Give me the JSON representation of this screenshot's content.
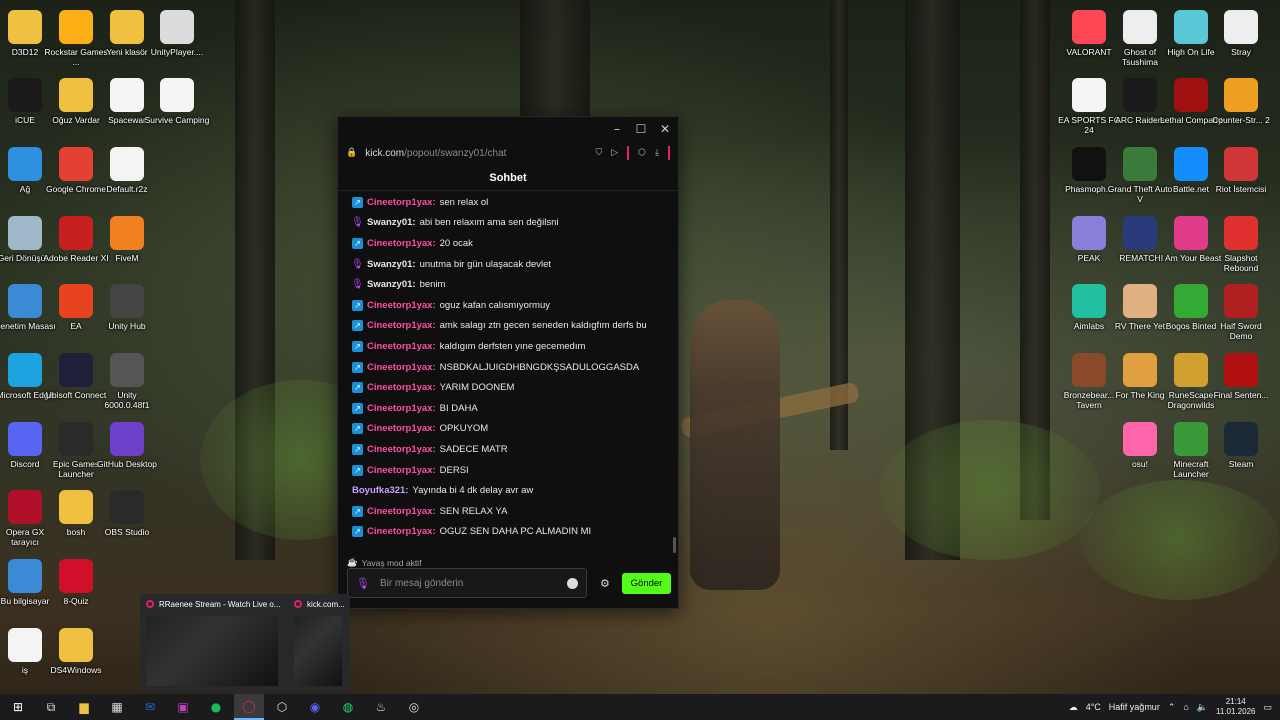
{
  "desktop_icons": [
    {
      "label": "D3D12",
      "icon": "folder-icon",
      "color": "#f0c040"
    },
    {
      "label": "Rockstar Games ...",
      "icon": "rockstar-icon",
      "color": "#fcaf17"
    },
    {
      "label": "Yeni klasör",
      "icon": "folder-icon",
      "color": "#f0c040"
    },
    {
      "label": "UnityPlayer....",
      "icon": "file-icon",
      "color": "#dcdcdc"
    },
    {
      "label": "iCUE",
      "icon": "icue-icon",
      "color": "#1a1a1a"
    },
    {
      "label": "Oğuz Vardar",
      "icon": "folder-icon",
      "color": "#f0c040"
    },
    {
      "label": "Spacewar",
      "icon": "file-icon",
      "color": "#f4f4f4"
    },
    {
      "label": "Survive Camping",
      "icon": "file-icon",
      "color": "#f4f4f4"
    },
    {
      "label": "Ağ",
      "icon": "network-icon",
      "color": "#2d8fe0"
    },
    {
      "label": "Google Chrome",
      "icon": "chrome-icon",
      "color": "#e44134"
    },
    {
      "label": "Default.r2z",
      "icon": "file-icon",
      "color": "#f4f4f4"
    },
    {
      "label": "Geri Dönüşü...",
      "icon": "recycle-bin-icon",
      "color": "#9fb7c9"
    },
    {
      "label": "Adobe Reader XI",
      "icon": "adobe-icon",
      "color": "#c8201e"
    },
    {
      "label": "FiveM",
      "icon": "fivem-icon",
      "color": "#f08020"
    },
    {
      "label": "Denetim Masası",
      "icon": "control-panel-icon",
      "color": "#3a8ad6"
    },
    {
      "label": "EA",
      "icon": "ea-icon",
      "color": "#e8431f"
    },
    {
      "label": "Unity Hub",
      "icon": "unity-icon",
      "color": "#444"
    },
    {
      "label": "Microsoft Edge",
      "icon": "edge-icon",
      "color": "#1da3e0"
    },
    {
      "label": "Ubisoft Connect",
      "icon": "ubisoft-icon",
      "color": "#1f1f3a"
    },
    {
      "label": "Unity 6000.0.48f1",
      "icon": "unity-icon",
      "color": "#555"
    },
    {
      "label": "Discord",
      "icon": "discord-icon",
      "color": "#5865f2"
    },
    {
      "label": "Epic Games Launcher",
      "icon": "epic-icon",
      "color": "#2a2a2a"
    },
    {
      "label": "GitHub Desktop",
      "icon": "github-icon",
      "color": "#6e40c9"
    },
    {
      "label": "Opera GX tarayıcı",
      "icon": "opera-gx-icon",
      "color": "#b0102a"
    },
    {
      "label": "bosh",
      "icon": "folder-icon",
      "color": "#f0c040"
    },
    {
      "label": "OBS Studio",
      "icon": "obs-icon",
      "color": "#2a2a2a"
    },
    {
      "label": "Bu bilgisayar",
      "icon": "computer-icon",
      "color": "#3a8ad6"
    },
    {
      "label": "8-Quiz",
      "icon": "opera-icon",
      "color": "#d0102a"
    },
    {
      "label": "iş",
      "icon": "file-icon",
      "color": "#f4f4f4"
    },
    {
      "label": "DS4Windows",
      "icon": "folder-icon",
      "color": "#f0c040"
    },
    {
      "label": "VALORANT",
      "icon": "valorant-icon",
      "color": "#ff4655"
    },
    {
      "label": "Ghost of Tsushima",
      "icon": "ghost-icon",
      "color": "#eee"
    },
    {
      "label": "High On Life",
      "icon": "high-on-life-icon",
      "color": "#5bc8d8"
    },
    {
      "label": "Stray",
      "icon": "stray-icon",
      "color": "#eee"
    },
    {
      "label": "EA SPORTS FC 24",
      "icon": "fc24-icon",
      "color": "#f4f4f4"
    },
    {
      "label": "ARC Raiders",
      "icon": "arc-raiders-icon",
      "color": "#1a1a1a"
    },
    {
      "label": "Lethal Company",
      "icon": "lethal-company-icon",
      "color": "#a01010"
    },
    {
      "label": "Counter-Str... 2",
      "icon": "cs2-icon",
      "color": "#f0a020"
    },
    {
      "label": "Phasmoph...",
      "icon": "phasmophobia-icon",
      "color": "#111"
    },
    {
      "label": "Grand Theft Auto V",
      "icon": "gta-icon",
      "color": "#3a7a3a"
    },
    {
      "label": "Battle.net",
      "icon": "battlenet-icon",
      "color": "#148eff"
    },
    {
      "label": "Riot İstemcisi",
      "icon": "riot-icon",
      "color": "#d13639"
    },
    {
      "label": "PEAK",
      "icon": "peak-icon",
      "color": "#8a7fd8"
    },
    {
      "label": "REMATCH",
      "icon": "rematch-icon",
      "color": "#2a3a7a"
    },
    {
      "label": "I Am Your Beast",
      "icon": "beast-icon",
      "color": "#e03a8a"
    },
    {
      "label": "Slapshot Rebound",
      "icon": "slapshot-icon",
      "color": "#e03030"
    },
    {
      "label": "Aimlabs",
      "icon": "aimlabs-icon",
      "color": "#20c0a0"
    },
    {
      "label": "RV There Yet",
      "icon": "rv-icon",
      "color": "#e0b080"
    },
    {
      "label": "Bogos Binted",
      "icon": "bogos-icon",
      "color": "#3a3"
    },
    {
      "label": "Half Sword Demo",
      "icon": "half-sword-icon",
      "color": "#b02020"
    },
    {
      "label": "Bronzebear... Tavern",
      "icon": "tavern-icon",
      "color": "#8a4a2a"
    },
    {
      "label": "For The King",
      "icon": "for-the-king-icon",
      "color": "#e0a040"
    },
    {
      "label": "RuneScape Dragonwilds",
      "icon": "runescape-icon",
      "color": "#d0a030"
    },
    {
      "label": "Final Senten...",
      "icon": "final-sentence-icon",
      "color": "#b01010"
    },
    {
      "label": "osu!",
      "icon": "osu-icon",
      "color": "#ff66aa"
    },
    {
      "label": "Minecraft Launcher",
      "icon": "minecraft-icon",
      "color": "#3a9a3a"
    },
    {
      "label": "Steam",
      "icon": "steam-icon",
      "color": "#1b2838"
    }
  ],
  "chat_window": {
    "url_host": "kick.com",
    "url_path": "/popout/swanzy01/chat",
    "header": "Sohbet",
    "slow_mode": "Yavaş mod aktif",
    "input_placeholder": "Bir mesaj gönderin",
    "send_label": "Gönder",
    "accent": "#53fc18",
    "messages": [
      {
        "user": "Cineetorp1yax",
        "text": "sen relax ol",
        "badge": "blue",
        "color": "#ff4ea3"
      },
      {
        "user": "Swanzy01",
        "text": "abi ben relaxım ama sen değilsni",
        "badge": "mic",
        "color": "#e8e8e8"
      },
      {
        "user": "Cineetorp1yax",
        "text": "20 ocak",
        "badge": "blue",
        "color": "#ff4ea3"
      },
      {
        "user": "Swanzy01",
        "text": "unutma bir gün ulaşacak devlet",
        "badge": "mic",
        "color": "#e8e8e8"
      },
      {
        "user": "Swanzy01",
        "text": "benim",
        "badge": "mic",
        "color": "#e8e8e8"
      },
      {
        "user": "Cineetorp1yax",
        "text": "oguz kafan calısmıyormuy",
        "badge": "blue",
        "color": "#ff4ea3"
      },
      {
        "user": "Cineetorp1yax",
        "text": "amk salagı ztn gecen seneden kaldıgfım derfs bu",
        "badge": "blue",
        "color": "#ff4ea3"
      },
      {
        "user": "Cineetorp1yax",
        "text": "kaldıgım derfsten yıne gecemedım",
        "badge": "blue",
        "color": "#ff4ea3"
      },
      {
        "user": "Cineetorp1yax",
        "text": "NSBDKALJUIGDHBNGDKŞSADULOGGASDA",
        "badge": "blue",
        "color": "#ff4ea3"
      },
      {
        "user": "Cineetorp1yax",
        "text": "YARIM DOONEM",
        "badge": "blue",
        "color": "#ff4ea3"
      },
      {
        "user": "Cineetorp1yax",
        "text": "BI DAHA",
        "badge": "blue",
        "color": "#ff4ea3"
      },
      {
        "user": "Cineetorp1yax",
        "text": "OPKUYOM",
        "badge": "blue",
        "color": "#ff4ea3"
      },
      {
        "user": "Cineetorp1yax",
        "text": "SADECE MATR",
        "badge": "blue",
        "color": "#ff4ea3"
      },
      {
        "user": "Cineetorp1yax",
        "text": "DERSI",
        "badge": "blue",
        "color": "#ff4ea3"
      },
      {
        "user": "Boyufka321",
        "text": "Yayında bi 4 dk delay avr aw",
        "badge": "none",
        "color": "#c9a0ff"
      },
      {
        "user": "Cineetorp1yax",
        "text": "SEN RELAX YA",
        "badge": "blue",
        "color": "#ff4ea3"
      },
      {
        "user": "Cineetorp1yax",
        "text": "OGUZ SEN DAHA PC ALMADIN MI",
        "badge": "blue",
        "color": "#ff4ea3"
      }
    ]
  },
  "taskbar_preview": {
    "items": [
      {
        "title": "RRaenee Stream - Watch Live o..."
      },
      {
        "title": "kick.com..."
      }
    ]
  },
  "taskbar": {
    "weather": "4°C",
    "weather_desc": "Hafif yağmur",
    "time": "21:14",
    "date": "11.01.2026"
  }
}
